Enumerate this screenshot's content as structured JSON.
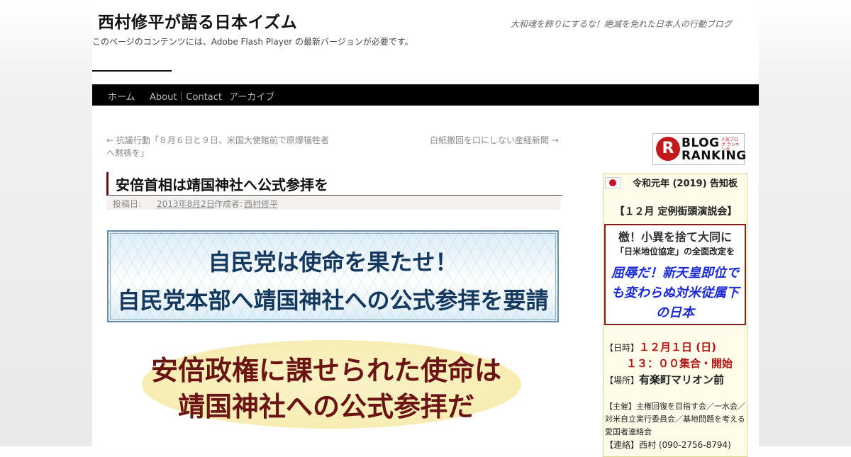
{
  "site": {
    "title": "西村修平が語る日本イズム",
    "description": "大和魂を飾りにするな！絶滅を免れた日本人の行動ブログ",
    "flash_notice": "このページのコンテンツには、Adobe Flash Player の最新バージョンが必要です。"
  },
  "nav": {
    "items": [
      "ホーム",
      "About｜Contact",
      "アーカイブ"
    ]
  },
  "post_nav": {
    "prev_line1": "← 抗議行動「８月６日と９日、米国大使館前で原爆犠牲者",
    "prev_line2": "へ黙祷を」",
    "next": "白紙撤回を口にしない産経新聞 →"
  },
  "post": {
    "title": "安倍首相は靖国神社へ公式参拝を",
    "meta_prefix": "投稿日:",
    "date": "2013年8月2日",
    "author_prefix": "作成者:",
    "author": "西村修平",
    "banner1_line1": "自民党は使命を果たせ！",
    "banner1_line2": "自民党本部へ靖国神社への公式参拝を要請",
    "banner2_line1": "安倍政権に課せられた使命は",
    "banner2_line2": "靖国神社への公式参拝だ"
  },
  "sidebar": {
    "ranking": {
      "top": "BLOG",
      "small": "人気ブログ ランキング",
      "bottom": "RANKING",
      "mark": "R"
    },
    "notice": {
      "title": "令和元年 (2019) 告知板",
      "event": "【１２月 定例街頭演説会】",
      "box_h1": "檄！小異を捨て大同に",
      "box_h2": "「日米地位協定」の全面改定を",
      "box_h3": "屈辱だ！新天皇即位でも変わらぬ対米従属下の日本",
      "date_label": "【日時】",
      "date": "１２月１日 (日)",
      "time": "１３：００集合・開始",
      "place_label": "【場所】",
      "place": "有楽町マリオン前",
      "org": "【主催】主権回復を目指す会／一水会／対米自立実行委員会／基地問題を考える愛国者連絡会",
      "contact": "【連絡】西村 (090-2756-8794)"
    }
  }
}
